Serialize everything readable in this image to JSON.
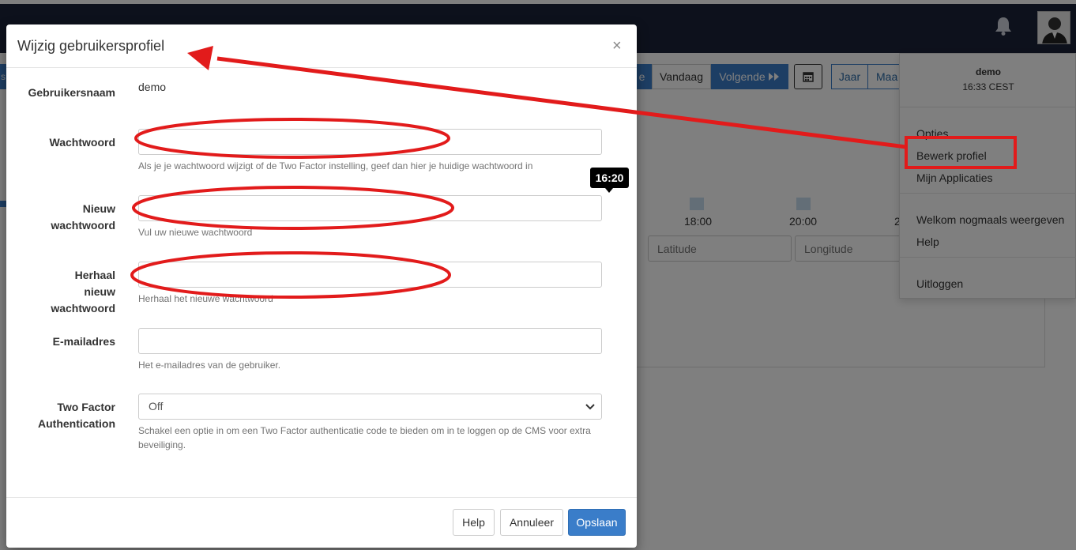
{
  "topbar": {
    "bell_icon": "bell-icon",
    "avatar_icon": "user-avatar-icon"
  },
  "calendar": {
    "prev_partial": "e",
    "today_label": "Vandaag",
    "next_label": "Volgende",
    "calendar_icon": "calendar-icon",
    "year_label": "Jaar",
    "month_partial": "Maa",
    "times": [
      "18:00",
      "20:00",
      "2"
    ],
    "latitude_placeholder": "Latitude",
    "longitude_placeholder": "Longitude",
    "left_tab_partial": "s"
  },
  "user_menu": {
    "username": "demo",
    "time": "16:33 CEST",
    "items": [
      {
        "label": "Opties"
      },
      {
        "label": "Bewerk profiel"
      },
      {
        "label": "Mijn Applicaties"
      },
      {
        "label": "Welkom nogmaals weergeven"
      },
      {
        "label": "Help"
      },
      {
        "label": "Uitloggen"
      }
    ]
  },
  "modal": {
    "title": "Wijzig gebruikersprofiel",
    "close": "×",
    "username_label": "Gebruikersnaam",
    "username_value": "demo",
    "password_label": "Wachtwoord",
    "password_help": "Als je je wachtwoord wijzigt of de Two Factor instelling, geef dan hier je huidige wachtwoord in",
    "new_password_label_lines": [
      "Nieuw",
      "wachtwoord"
    ],
    "new_password_help": "Vul uw nieuwe wachtwoord",
    "repeat_password_label_lines": [
      "Herhaal",
      "nieuw",
      "wachtwoord"
    ],
    "repeat_password_help": "Herhaal het nieuwe wachtwoord",
    "email_label": "E-mailadres",
    "email_help": "Het e-mailadres van de gebruiker.",
    "twofactor_label_lines": [
      "Two Factor",
      "Authentication"
    ],
    "twofactor_value": "Off",
    "twofactor_help": "Schakel een optie in om een Two Factor authenticatie code te bieden om in te loggen op de CMS voor extra beveiliging.",
    "tooltip": "16:20",
    "buttons": {
      "help": "Help",
      "cancel": "Annuleer",
      "save": "Opslaan"
    }
  },
  "colors": {
    "topbar": "#1b2238",
    "primary": "#3a7dc9",
    "annotation_red": "#e21b1b"
  }
}
